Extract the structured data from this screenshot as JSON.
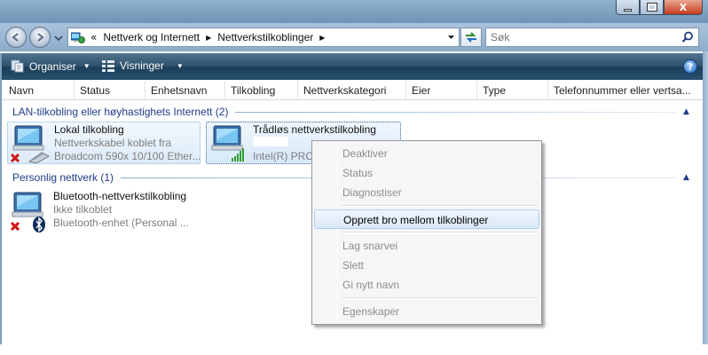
{
  "window": {
    "caption": {
      "minimize": "",
      "maximize": "",
      "close": "X"
    }
  },
  "address": {
    "breadcrumb_prefix": "«",
    "crumbs": [
      "Nettverk og Internett",
      "Nettverkstilkoblinger"
    ],
    "search_placeholder": "Søk"
  },
  "toolbar": {
    "organize_label": "Organiser",
    "views_label": "Visninger",
    "help_label": "?"
  },
  "columns": [
    "Navn",
    "Status",
    "Enhetsnavn",
    "Tilkobling",
    "Nettverkskategori",
    "Eier",
    "Type",
    "Telefonnummer eller vertsa..."
  ],
  "groups": [
    {
      "title": "LAN-tilkobling eller høyhastighets Internett (2)",
      "items": [
        {
          "name": "Lokal tilkobling",
          "status": "Nettverkskabel koblet fra",
          "device": "Broadcom 590x 10/100 Ether..."
        },
        {
          "name": "Trådløs nettverkstilkobling",
          "status": "",
          "device": "Intel(R) PRO"
        }
      ]
    },
    {
      "title": "Personlig nettverk (1)",
      "items": [
        {
          "name": "Bluetooth-nettverkstilkobling",
          "status": "Ikke tilkoblet",
          "device": "Bluetooth-enhet (Personal ..."
        }
      ]
    }
  ],
  "context_menu": {
    "items": [
      {
        "label": "Deaktiver",
        "enabled": false
      },
      {
        "label": "Status",
        "enabled": false
      },
      {
        "label": "Diagnostiser",
        "enabled": false
      },
      {
        "label": "Opprett bro mellom tilkoblinger",
        "enabled": true,
        "highlighted": true
      },
      {
        "label": "Lag snarvei",
        "enabled": false
      },
      {
        "label": "Slett",
        "enabled": false
      },
      {
        "label": "Gi nytt navn",
        "enabled": false
      },
      {
        "label": "Egenskaper",
        "enabled": false
      }
    ]
  },
  "colors": {
    "toolbar_dark": "#1c3e58",
    "group_title": "#1e3c87",
    "selection_bg": "#dcebf8",
    "disconnected_x": "#d21414",
    "signal_green": "#2f9e2f"
  },
  "icons": [
    "back-icon",
    "forward-icon",
    "network-folder-icon",
    "refresh-icon",
    "search-icon",
    "organize-icon",
    "views-icon",
    "help-icon",
    "lan-adapter-icon",
    "wireless-adapter-icon",
    "bluetooth-adapter-icon"
  ]
}
